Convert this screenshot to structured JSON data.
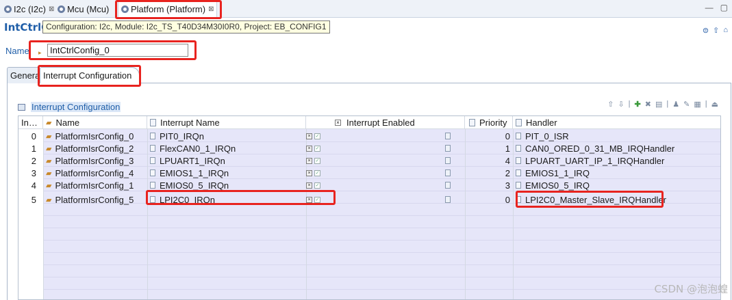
{
  "tabs": [
    {
      "label": "I2c (I2c)",
      "close": "⊠"
    },
    {
      "label": "Mcu (Mcu)",
      "close": ""
    },
    {
      "label": "Platform (Platform)",
      "close": "⊠"
    }
  ],
  "window_buttons": [
    "—",
    "▢"
  ],
  "header": {
    "title": "IntCtrlC",
    "tooltip": "Configuration: I2c, Module: I2c_TS_T40D34M30I0R0, Project: EB_CONFIG1"
  },
  "name_field": {
    "label": "Name",
    "value": "IntCtrlConfig_0"
  },
  "inner_tabs": [
    "General",
    "Interrupt Configuration"
  ],
  "section": {
    "title": "Interrupt Configuration"
  },
  "table": {
    "columns": {
      "index": "In…",
      "name": "Name",
      "irq": "Interrupt Name",
      "enabled": "Interrupt Enabled",
      "priority": "Priority",
      "handler": "Handler"
    },
    "rows": [
      {
        "index": "0",
        "name": "PlatformIsrConfig_0",
        "irq": "PIT0_IRQn",
        "priority": "0",
        "handler": "PIT_0_ISR"
      },
      {
        "index": "1",
        "name": "PlatformIsrConfig_2",
        "irq": "FlexCAN0_1_IRQn",
        "priority": "1",
        "handler": "CAN0_ORED_0_31_MB_IRQHandler"
      },
      {
        "index": "2",
        "name": "PlatformIsrConfig_3",
        "irq": "LPUART1_IRQn",
        "priority": "4",
        "handler": "LPUART_UART_IP_1_IRQHandler"
      },
      {
        "index": "3",
        "name": "PlatformIsrConfig_4",
        "irq": "EMIOS1_1_IRQn",
        "priority": "2",
        "handler": "EMIOS1_1_IRQ"
      },
      {
        "index": "4",
        "name": "PlatformIsrConfig_1",
        "irq": "EMIOS0_5_IRQn",
        "priority": "3",
        "handler": "EMIOS0_5_IRQ"
      },
      {
        "index": "5",
        "name": "PlatformIsrConfig_5",
        "irq": "LPI2C0_IRQn",
        "priority": "0",
        "handler": "LPI2C0_Master_Slave_IRQHandler"
      }
    ]
  },
  "watermark": "CSDN @泡泡蝗",
  "colors": {
    "highlight": "#e8231f",
    "row_band": "#e6e6f9",
    "link_blue": "#1f5ea8"
  }
}
